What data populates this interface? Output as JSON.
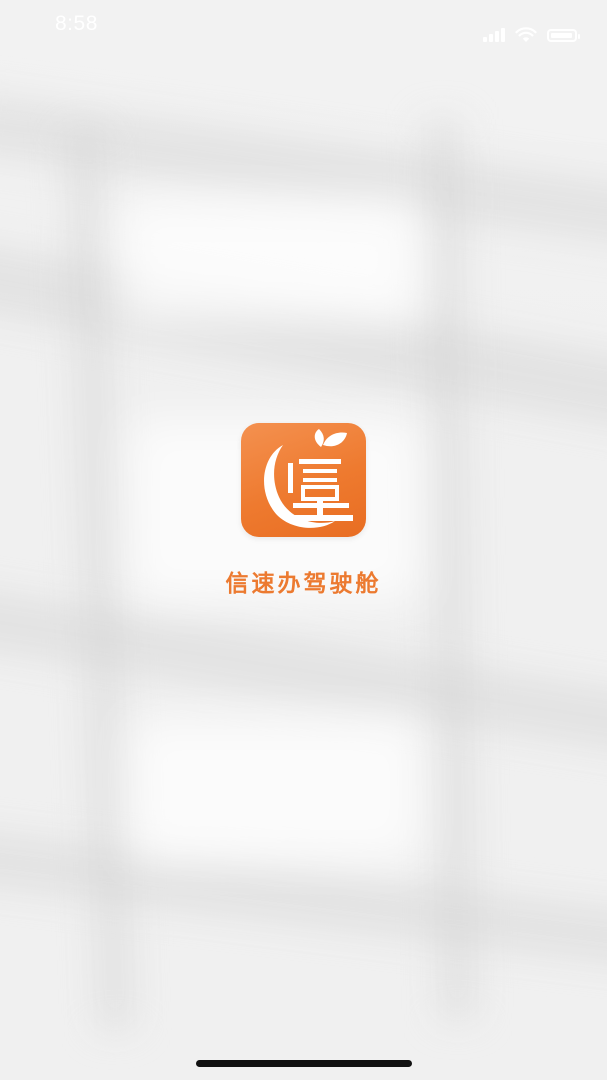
{
  "status_bar": {
    "time": "8:58",
    "battery_level": 0.95,
    "icons": [
      "cellular-signal-icon",
      "wifi-icon",
      "battery-icon"
    ]
  },
  "splash": {
    "app_name": "信速办驾驶舱",
    "logo_icon": "app-logo-icon",
    "accent_color": "#ee7a2f",
    "text_color": "#ec7a30"
  }
}
